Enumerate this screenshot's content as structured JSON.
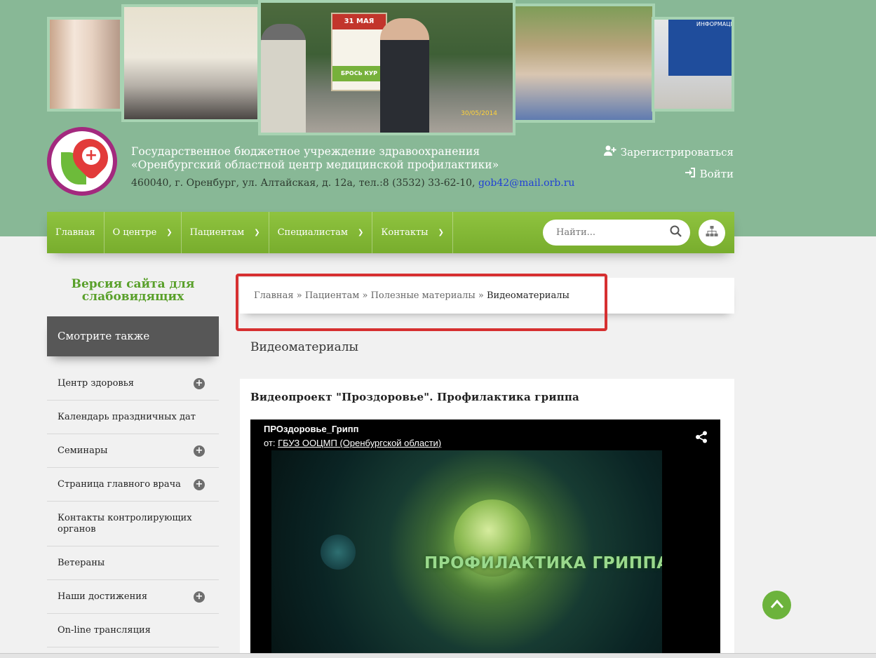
{
  "header": {
    "org_line1": "Государственное бюджетное учреждение здравоохранения",
    "org_line2": "«Оренбургский областной центр медицинской профилактики»",
    "address": "460040, г. Оренбург, ул. Алтайская, д. 12а, тел.:8 (3532) 33-62-10, ",
    "email": "gob42@mail.orb.ru",
    "photo_sign_top": "31 МАЯ",
    "photo_sign_bottom": "БРОСЬ КУР",
    "photo_date": "30/05/2014",
    "photo_board": "ИНФОРМАЦИЯ"
  },
  "auth": {
    "register": "Зарегистрироваться",
    "login": "Войти"
  },
  "nav": {
    "items": [
      "Главная",
      "О центре",
      "Пациентам",
      "Специалистам",
      "Контакты"
    ],
    "search_placeholder": "Найти..."
  },
  "sidebar": {
    "vision_link": "Версия сайта для слабовидящих",
    "see_also": "Смотрите также",
    "items": [
      "Центр здоровья",
      "Календарь праздничных дат",
      "Семинары",
      "Страница главного врача",
      "Контакты контролирующих органов",
      "Ветераны",
      "Наши достижения",
      "On-line трансляция"
    ]
  },
  "breadcrumb": {
    "items": [
      "Главная",
      "Пациентам",
      "Полезные материалы"
    ],
    "current": "Видеоматериалы",
    "separator": "»"
  },
  "page": {
    "title": "Видеоматериалы",
    "video_heading": "Видеопроект \"Проздоровье\". Профилактика гриппа",
    "video_name": "ПРОздоровье_Грипп",
    "video_from_prefix": "от: ",
    "video_channel": "ГБУЗ ООЦМП (Оренбургской области)",
    "video_overlay": "ПРОФИЛАКТИКА ГРИППА"
  },
  "colors": {
    "header_bg": "#88b896",
    "nav_green": "#8fc33f",
    "accent_green": "#59a02a",
    "highlight_red": "#d63031",
    "see_also_bg": "#575757"
  },
  "icons": [
    "user-plus-icon",
    "login-icon",
    "chevron-down-icon",
    "search-icon",
    "sitemap-icon",
    "plus-circle-icon",
    "share-icon",
    "arrow-up-icon"
  ]
}
